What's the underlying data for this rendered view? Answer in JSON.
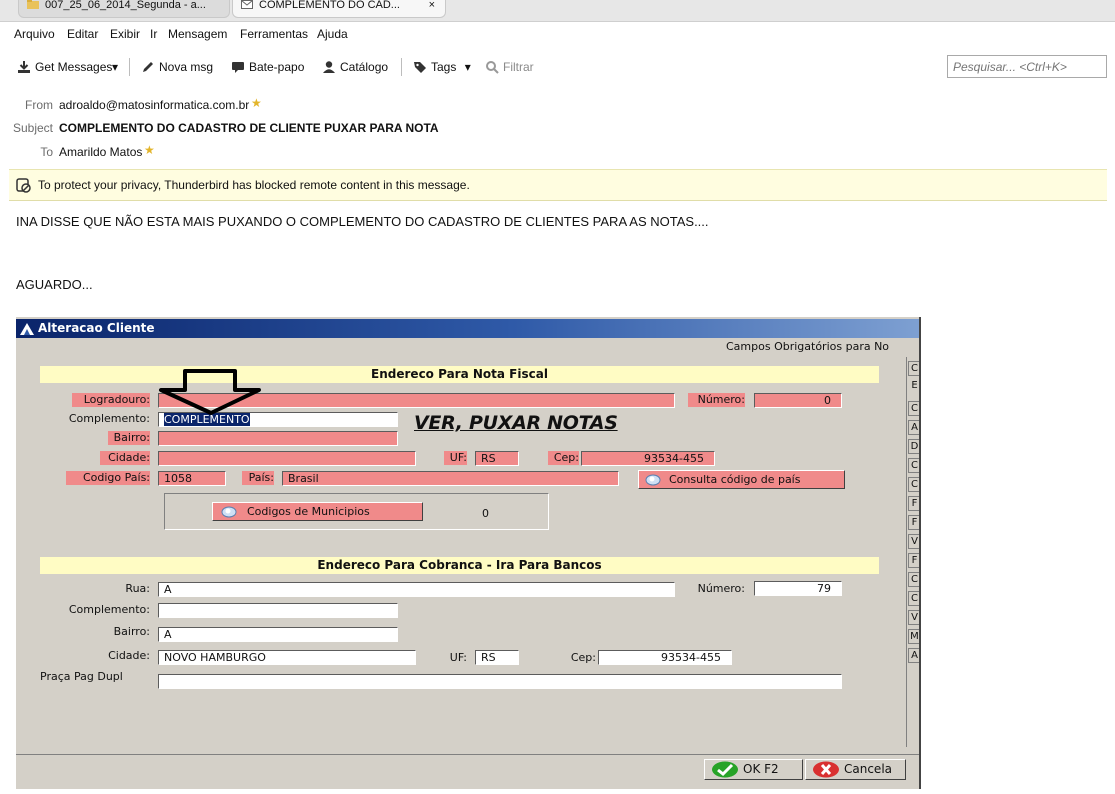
{
  "tabs": [
    {
      "label": "007_25_06_2014_Segunda - a..."
    },
    {
      "label": "COMPLEMENTO DO CAD...",
      "close": "×"
    }
  ],
  "menu": [
    "Arquivo",
    "Editar",
    "Exibir",
    "Ir",
    "Mensagem",
    "Ferramentas",
    "Ajuda"
  ],
  "toolbar": {
    "get_messages": "Get Messages",
    "dropdown_glyph": "▾",
    "nova_msg": "Nova msg",
    "bate_papo": "Bate-papo",
    "catalogo": "Catálogo",
    "tags": "Tags",
    "filtrar": "Filtrar"
  },
  "search": {
    "placeholder": "Pesquisar... <Ctrl+K>"
  },
  "header": {
    "from_label": "From",
    "from_value": "adroaldo@matosinformatica.com.br",
    "subject_label": "Subject",
    "subject_value": "COMPLEMENTO DO CADASTRO DE CLIENTE PUXAR PARA NOTA",
    "to_label": "To",
    "to_value": "Amarildo Matos"
  },
  "privacy_notice": "To protect your privacy, Thunderbird has blocked remote content in this message.",
  "message": {
    "line1": "INA DISSE QUE NÃO ESTA MAIS PUXANDO O COMPLEMENTO DO CADASTRO DE CLIENTES PARA AS NOTAS....",
    "line2": "AGUARDO..."
  },
  "dialog": {
    "title": "Alteracao Cliente",
    "required_note": "Campos Obrigatórios para No",
    "section1": "Endereco Para Nota Fiscal",
    "section2": "Endereco Para Cobranca - Ira Para Bancos",
    "annotation": "VER, PUXAR NOTAS",
    "nf": {
      "logradouro_label": "Logradouro:",
      "logradouro_value": "",
      "numero_label": "Número:",
      "numero_value": "0",
      "complemento_label": "Complemento:",
      "complemento_value": "COMPLEMENTO",
      "bairro_label": "Bairro:",
      "bairro_value": "",
      "cidade_label": "Cidade:",
      "cidade_value": "",
      "uf_label": "UF:",
      "uf_value": "RS",
      "cep_label": "Cep:",
      "cep_value": "93534-455",
      "codigo_pais_label": "Codigo País:",
      "codigo_pais_value": "1058",
      "pais_label": "País:",
      "pais_value": "Brasil",
      "consulta_button": "Consulta código de país",
      "municipios_button": "Codigos de Municipios",
      "municipios_value": "0"
    },
    "cob": {
      "rua_label": "Rua:",
      "rua_value": "A",
      "numero_label": "Número:",
      "numero_value": "79",
      "complemento_label": "Complemento:",
      "complemento_value": "",
      "bairro_label": "Bairro:",
      "bairro_value": "A",
      "cidade_label": "Cidade:",
      "cidade_value": "NOVO HAMBURGO",
      "uf_label": "UF:",
      "uf_value": "RS",
      "cep_label": "Cep:",
      "cep_value": "93534-455",
      "praca_label": "Praça Pag Dupl",
      "praca_value": ""
    },
    "side_tabs": [
      "C",
      "E",
      "C",
      "A",
      "D",
      "C",
      "C",
      "F",
      "F",
      "V",
      "F",
      "C",
      "C",
      "V",
      "M",
      "A"
    ],
    "ok_button": "OK F2",
    "cancel_button": "Cancela"
  },
  "colors": {
    "required_field": "#f08a8a",
    "section_header": "#fffcc4",
    "privacy_bar": "#fffde0",
    "dialog_title": "#0a246a"
  }
}
